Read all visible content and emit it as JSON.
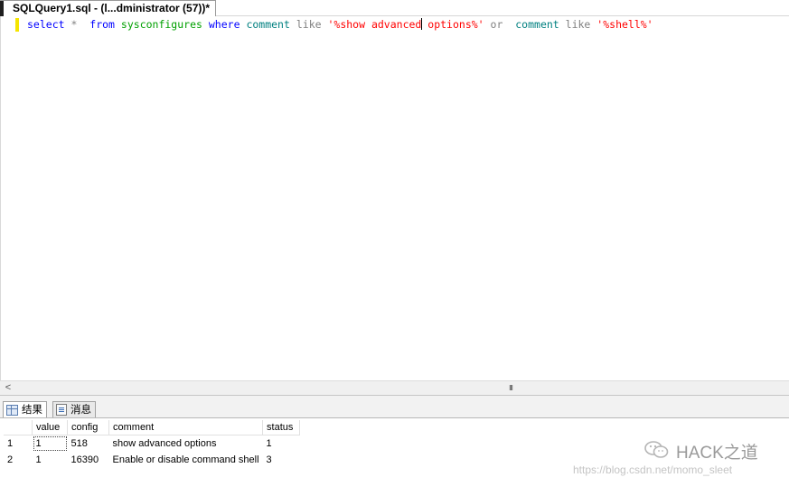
{
  "document_tab": {
    "title": "SQLQuery1.sql - (l...dministrator (57))*"
  },
  "editor": {
    "tokens": {
      "select": "select",
      "star": "*",
      "from": "from",
      "table": "sysconfigures",
      "where": "where",
      "col1": "comment",
      "like1": "like",
      "str1_a": "'%show advanced",
      "str1_b": "options%'",
      "or": "or",
      "col2": "comment",
      "like2": "like",
      "str2": "'%shell%'"
    }
  },
  "scrollbar": {
    "left_arrow": "<",
    "grip": "III"
  },
  "result_tabs": {
    "results": "结果",
    "messages": "消息"
  },
  "results": {
    "columns": [
      "value",
      "config",
      "comment",
      "status"
    ],
    "rows": [
      {
        "rownum": "1",
        "value": "1",
        "config": "518",
        "comment": "show advanced options",
        "status": "1"
      },
      {
        "rownum": "2",
        "value": "1",
        "config": "16390",
        "comment": "Enable or disable command shell",
        "status": "3"
      }
    ]
  },
  "watermark": {
    "brand": "HACK之道",
    "url": "https://blog.csdn.net/momo_sleet"
  },
  "icons": [
    "grid-icon",
    "message-icon",
    "wechat-icon"
  ],
  "colors": {
    "keyword": "#0000ff",
    "operator": "#808080",
    "table": "#00a000",
    "column": "#008080",
    "string": "#ff0000",
    "gutter_marker": "#f5e500"
  }
}
